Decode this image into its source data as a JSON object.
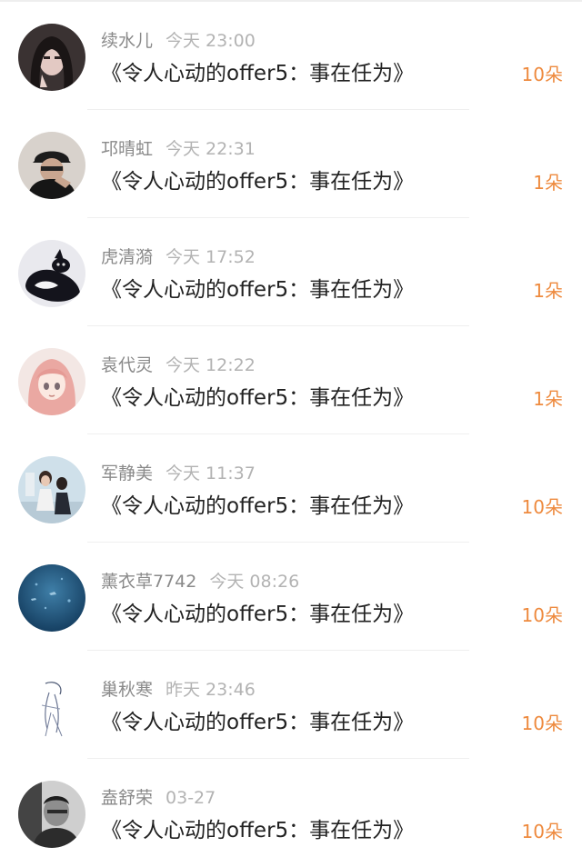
{
  "colors": {
    "count": "#ee8a3e",
    "name": "#8a8a8a",
    "time": "#b3b3b3",
    "message": "#222222"
  },
  "items": [
    {
      "name": "续水儿",
      "time": "今天 23:00",
      "message": "《令人心动的offer5：事在任为》",
      "count": "10朵",
      "avatar": "avatar-woman-dark-hair"
    },
    {
      "name": "邛晴虹",
      "time": "今天 22:31",
      "message": "《令人心动的offer5：事在任为》",
      "count": "1朵",
      "avatar": "avatar-man-cap"
    },
    {
      "name": "虎清漪",
      "time": "今天 17:52",
      "message": "《令人心动的offer5：事在任为》",
      "count": "1朵",
      "avatar": "avatar-black-white-cat"
    },
    {
      "name": "袁代灵",
      "time": "今天 12:22",
      "message": "《令人心动的offer5：事在任为》",
      "count": "1朵",
      "avatar": "avatar-anime-girl"
    },
    {
      "name": "军静美",
      "time": "今天 11:37",
      "message": "《令人心动的offer5：事在任为》",
      "count": "10朵",
      "avatar": "avatar-couple-photo"
    },
    {
      "name": "薰衣草7742",
      "time": "今天 08:26",
      "message": "《令人心动的offer5：事在任为》",
      "count": "10朵",
      "avatar": "avatar-blue-ocean"
    },
    {
      "name": "巢秋寒",
      "time": "昨天 23:46",
      "message": "《令人心动的offer5：事在任为》",
      "count": "10朵",
      "avatar": "avatar-sketch-figure"
    },
    {
      "name": "盍舒荣",
      "time": "03-27",
      "message": "《令人心动的offer5：事在任为》",
      "count": "10朵",
      "avatar": "avatar-man-portrait-bw"
    }
  ]
}
